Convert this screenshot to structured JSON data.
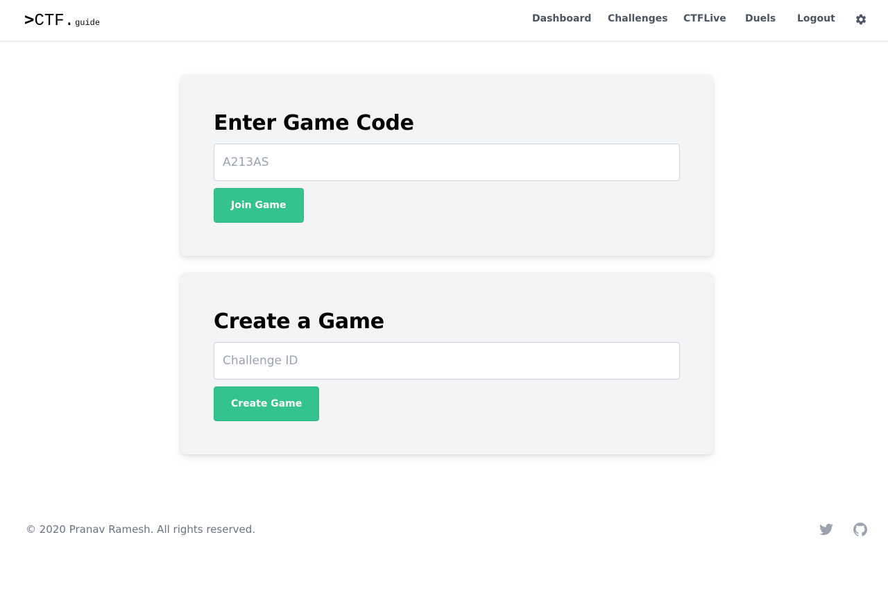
{
  "logo": {
    "caret": ">",
    "main": "CTF.",
    "sub": "guide"
  },
  "nav": {
    "items": [
      {
        "label": "Dashboard"
      },
      {
        "label": "Challenges"
      },
      {
        "label": "CTFLive"
      },
      {
        "label": "Duels"
      },
      {
        "label": "Logout"
      }
    ],
    "settings_icon": "gear-icon"
  },
  "join_card": {
    "title": "Enter Game Code",
    "input_value": "",
    "input_placeholder": "A213AS",
    "button_label": "Join Game"
  },
  "create_card": {
    "title": "Create a Game",
    "input_value": "",
    "input_placeholder": "Challenge ID",
    "button_label": "Create Game"
  },
  "footer": {
    "copyright": "© 2020 Pranav Ramesh. All rights reserved.",
    "social_icons": [
      "twitter-icon",
      "github-icon"
    ]
  },
  "colors": {
    "accent": "#34c38f",
    "card_bg": "#f3f4f6",
    "nav_text": "#4b5563",
    "muted_text": "#6b7280",
    "icon_gray": "#9ca3af"
  }
}
